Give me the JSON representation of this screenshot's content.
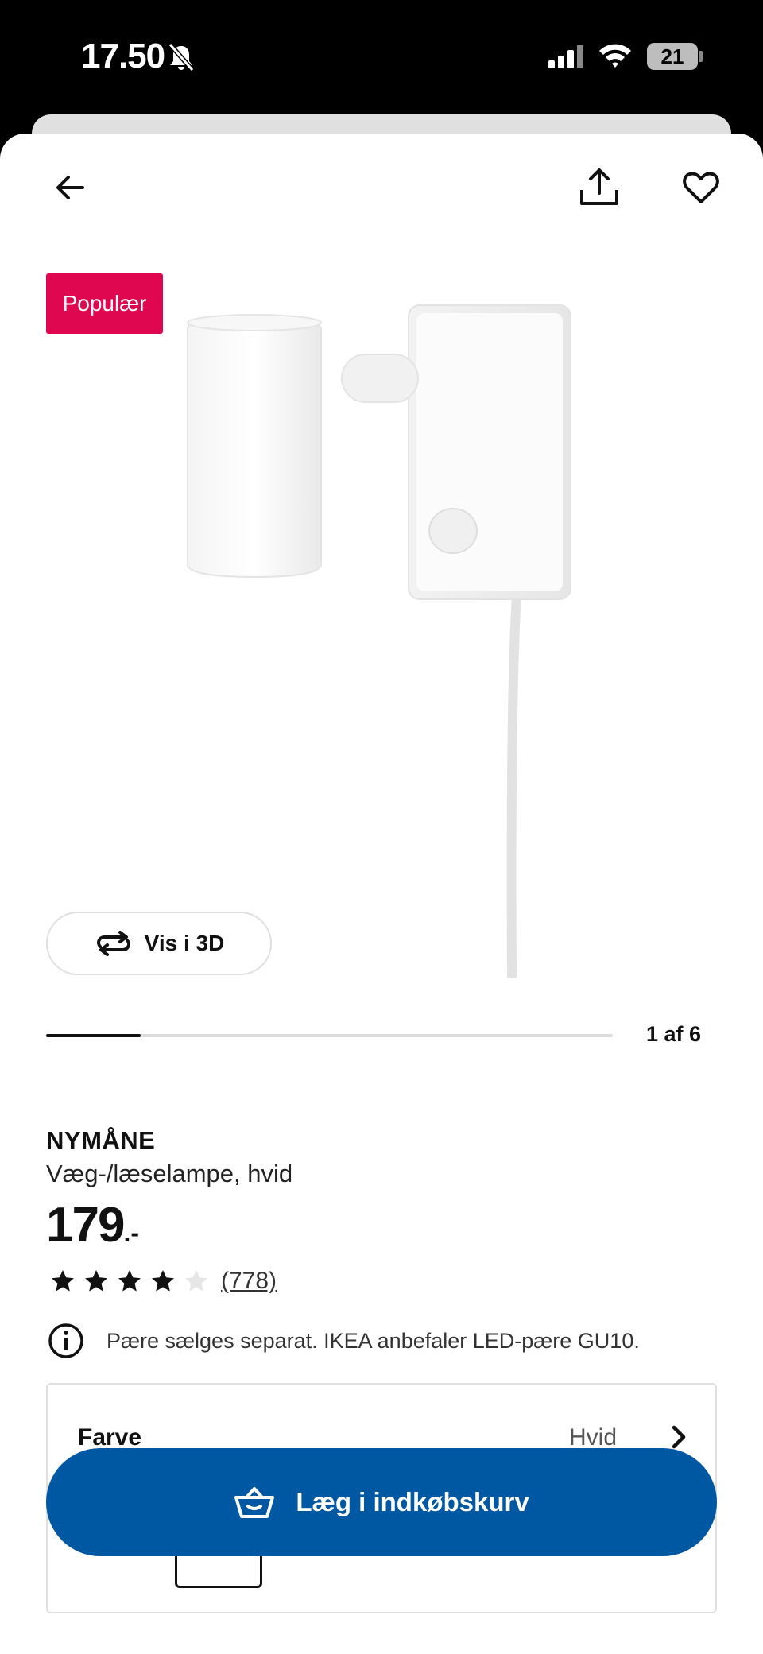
{
  "status_bar": {
    "time": "17.50",
    "battery": "21"
  },
  "header": {
    "icons": [
      "back-arrow-icon",
      "share-icon",
      "heart-icon"
    ]
  },
  "badge": "Populær",
  "view_3d": {
    "label": "Vis i 3D",
    "icon": "rotate-3d-icon"
  },
  "gallery": {
    "counter": "1 af 6",
    "current": 1,
    "total": 6
  },
  "product": {
    "name": "NYMÅNE",
    "description": "Væg-/læselampe, hvid",
    "price_int": "179",
    "price_suffix": ".-",
    "rating": 4,
    "rating_max": 5,
    "review_count": "(778)"
  },
  "notice": {
    "icon": "info-icon",
    "text": "Pære sælges separat. IKEA anbefaler LED-pære GU10."
  },
  "options": {
    "label": "Farve",
    "value": "Hvid"
  },
  "cart": {
    "label": "Læg i indkøbskurv",
    "icon": "basket-icon"
  },
  "colors": {
    "badge": "#e00751",
    "primary": "#0058a3"
  }
}
